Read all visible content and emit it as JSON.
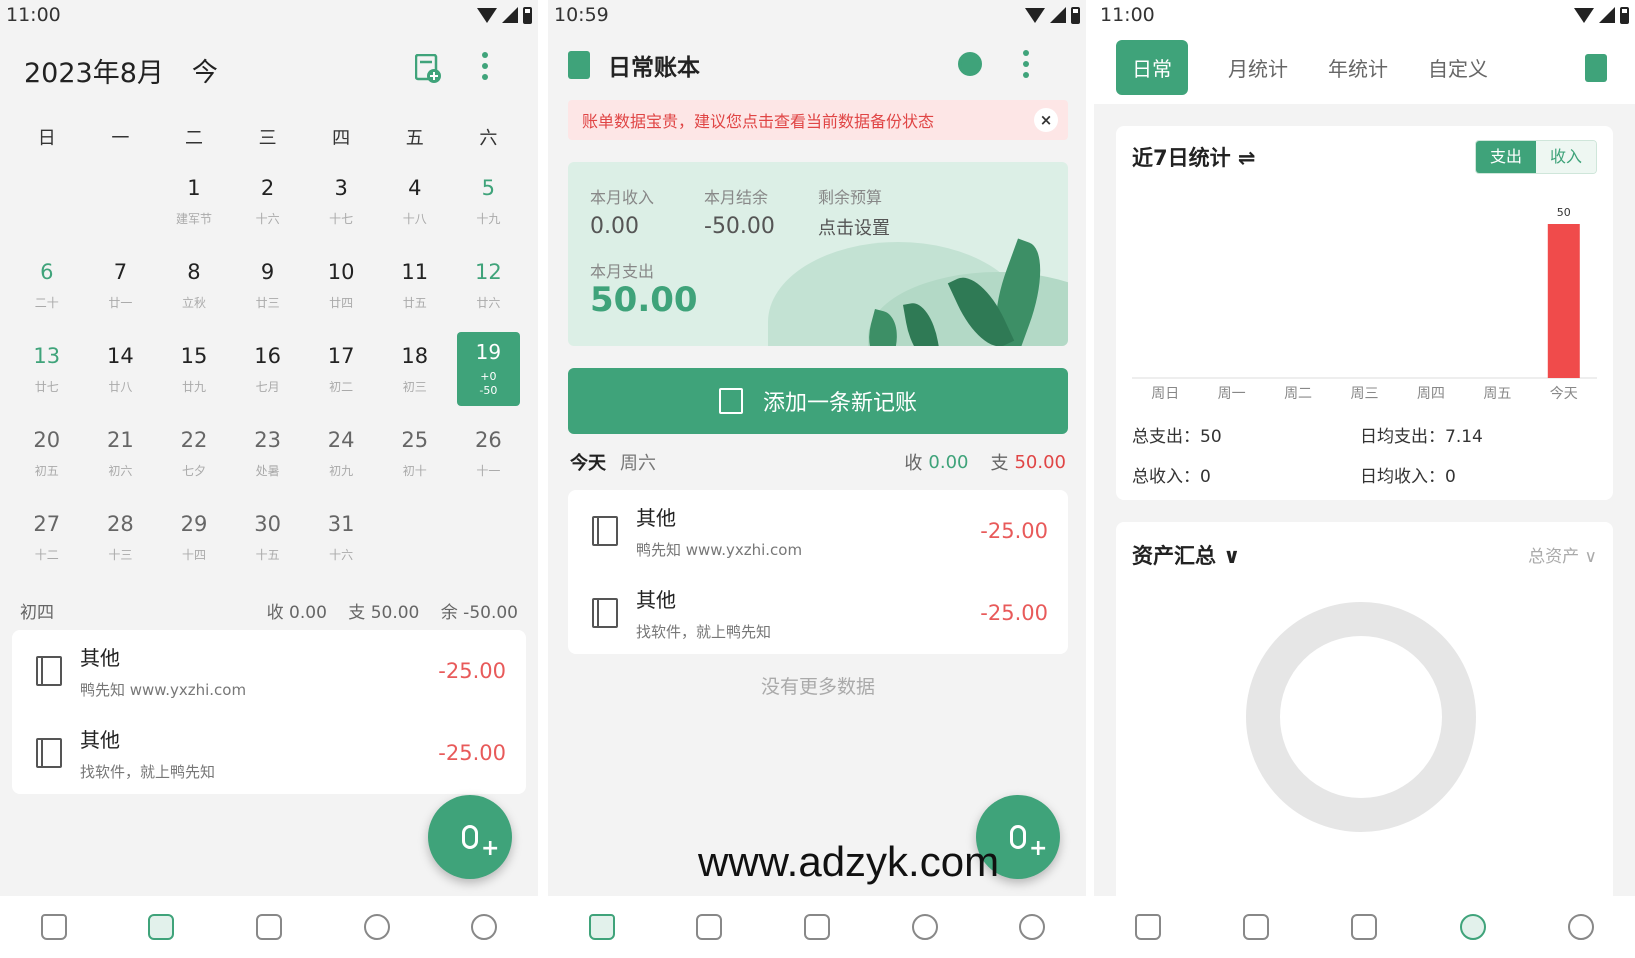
{
  "colors": {
    "accent": "#3fa37a",
    "expense": "#e04545"
  },
  "panel1": {
    "status_time": "11:00",
    "month_title": "2023年8月",
    "today_label": "今",
    "weekdays": [
      "日",
      "一",
      "二",
      "三",
      "四",
      "五",
      "六"
    ],
    "days": [
      {
        "n": "",
        "l": ""
      },
      {
        "n": "",
        "l": ""
      },
      {
        "n": "1",
        "l": "建军节"
      },
      {
        "n": "2",
        "l": "十六"
      },
      {
        "n": "3",
        "l": "十七"
      },
      {
        "n": "4",
        "l": "十八"
      },
      {
        "n": "5",
        "l": "十九"
      },
      {
        "n": "6",
        "l": "二十"
      },
      {
        "n": "7",
        "l": "廿一"
      },
      {
        "n": "8",
        "l": "立秋"
      },
      {
        "n": "9",
        "l": "廿三"
      },
      {
        "n": "10",
        "l": "廿四"
      },
      {
        "n": "11",
        "l": "廿五"
      },
      {
        "n": "12",
        "l": "廿六"
      },
      {
        "n": "13",
        "l": "廿七"
      },
      {
        "n": "14",
        "l": "廿八"
      },
      {
        "n": "15",
        "l": "廿九"
      },
      {
        "n": "16",
        "l": "七月"
      },
      {
        "n": "17",
        "l": "初二"
      },
      {
        "n": "18",
        "l": "初三"
      },
      {
        "n": "19",
        "l": "+0",
        "l2": "-50"
      },
      {
        "n": "20",
        "l": "初五"
      },
      {
        "n": "21",
        "l": "初六"
      },
      {
        "n": "22",
        "l": "七夕"
      },
      {
        "n": "23",
        "l": "处暑"
      },
      {
        "n": "24",
        "l": "初九"
      },
      {
        "n": "25",
        "l": "初十"
      },
      {
        "n": "26",
        "l": "十一"
      },
      {
        "n": "27",
        "l": "十二"
      },
      {
        "n": "28",
        "l": "十三"
      },
      {
        "n": "29",
        "l": "十四"
      },
      {
        "n": "30",
        "l": "十五"
      },
      {
        "n": "31",
        "l": "十六"
      }
    ],
    "summary": {
      "date": "初四",
      "income": "收 0.00",
      "expense": "支 50.00",
      "balance": "余 -50.00"
    },
    "entries": [
      {
        "title": "其他",
        "note": "鸭先知 www.yxzhi.com",
        "amount": "-25.00"
      },
      {
        "title": "其他",
        "note": "找软件，就上鸭先知",
        "amount": "-25.00"
      }
    ]
  },
  "panel2": {
    "status_time": "10:59",
    "title": "日常账本",
    "warning": "账单数据宝贵，建议您点击查看当前数据备份状态",
    "close_icon": "×",
    "month_income_label": "本月收入",
    "month_income": "0.00",
    "month_balance_label": "本月结余",
    "month_balance": "-50.00",
    "budget_label": "剩余预算",
    "budget_value": "点击设置",
    "month_expense_label": "本月支出",
    "month_expense": "50.00",
    "add_button": "添加一条新记账",
    "day_label": "今天",
    "weekday_label": "周六",
    "income_prefix": "收",
    "income_value": "0.00",
    "expense_prefix": "支",
    "expense_value": "50.00",
    "entries": [
      {
        "title": "其他",
        "note": "鸭先知 www.yxzhi.com",
        "amount": "-25.00"
      },
      {
        "title": "其他",
        "note": "找软件，就上鸭先知",
        "amount": "-25.00"
      }
    ],
    "no_more": "没有更多数据"
  },
  "panel3": {
    "status_time": "11:00",
    "tabs": [
      "日常",
      "月统计",
      "年统计",
      "自定义"
    ],
    "stat_title": "近7日统计 ⇌",
    "seg_expense": "支出",
    "seg_income": "收入",
    "total_expense": "总支出：50",
    "daily_expense": "日均支出：7.14",
    "total_income": "总收入：0",
    "daily_income": "日均收入：0",
    "asset_title": "资产汇总 ∨",
    "asset_select": "总资产 ∨"
  },
  "chart_data": {
    "type": "bar",
    "categories": [
      "周日",
      "周一",
      "周二",
      "周三",
      "周四",
      "周五",
      "今天"
    ],
    "values": [
      0,
      0,
      0,
      0,
      0,
      0,
      50
    ],
    "data_labels": [
      "",
      "",
      "",
      "",
      "",
      "",
      "50"
    ],
    "ylim": [
      0,
      50
    ]
  },
  "nav_icons": [
    "home-icon",
    "calendar-icon",
    "wallet-icon",
    "chart-icon",
    "more-icon"
  ],
  "watermark": "www.adzyk.com"
}
